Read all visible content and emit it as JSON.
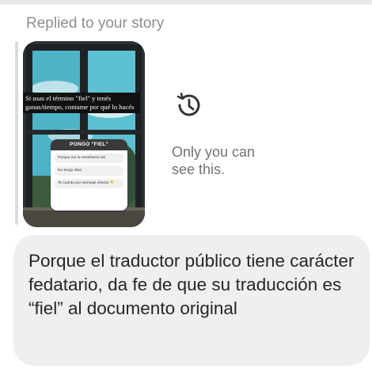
{
  "header": {
    "replied_label": "Replied to your story"
  },
  "story": {
    "caption": "Si usas el término \"fiel\" y tenés ganas/tiempo, contame por qué lo hacés",
    "poll_title": "PONGO \"FIEL\"",
    "poll_options": [
      "Porque me lo enseñaron así",
      "No tengo idea",
      "Te cuento por mensaje directo 👇"
    ]
  },
  "visibility": {
    "icon": "history-icon",
    "text_line1": "Only you can",
    "text_line2": "see this."
  },
  "message": {
    "text": "Porque el traductor público tiene carácter fedatario, da fe de que su traducción es “fiel” al documento original"
  },
  "colors": {
    "bubble": "#efefef",
    "muted_text": "#8e8e8e",
    "message_text": "#262626"
  }
}
